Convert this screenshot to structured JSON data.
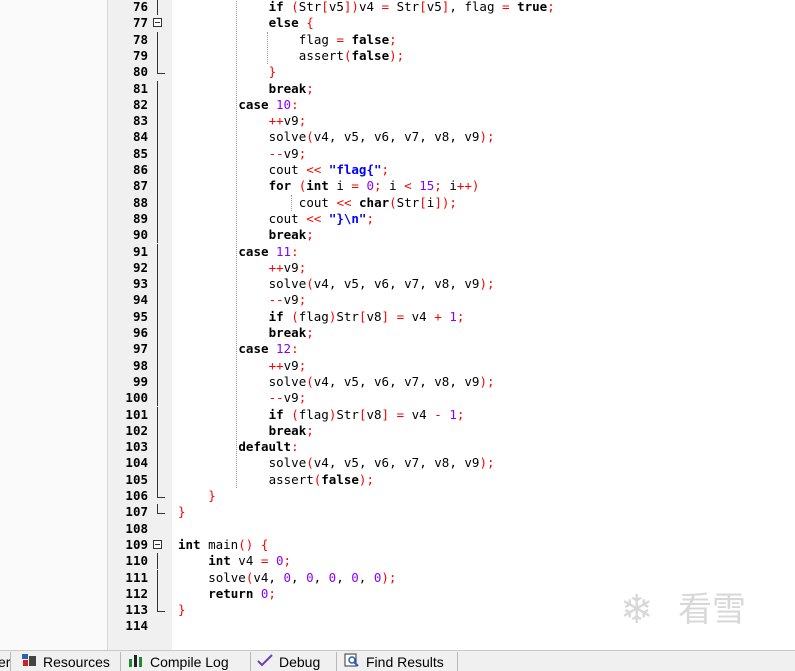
{
  "editor": {
    "lines": [
      {
        "n": "76",
        "code": "if (Str[v5])v4 = Str[v5], flag = true;",
        "indent": 3
      },
      {
        "n": "77",
        "code": "else {",
        "indent": 3
      },
      {
        "n": "78",
        "code": "flag = false;",
        "indent": 4
      },
      {
        "n": "79",
        "code": "assert(false);",
        "indent": 4
      },
      {
        "n": "80",
        "code": "}",
        "indent": 3
      },
      {
        "n": "81",
        "code": "break;",
        "indent": 3
      },
      {
        "n": "82",
        "code": "case 10:",
        "indent": 2
      },
      {
        "n": "83",
        "code": "++v9;",
        "indent": 3
      },
      {
        "n": "84",
        "code": "solve(v4, v5, v6, v7, v8, v9);",
        "indent": 3
      },
      {
        "n": "85",
        "code": "--v9;",
        "indent": 3
      },
      {
        "n": "86",
        "code": "cout << \"flag{\";",
        "indent": 3
      },
      {
        "n": "87",
        "code": "for (int i = 0; i < 15; i++)",
        "indent": 3
      },
      {
        "n": "88",
        "code": "cout << char(Str[i]);",
        "indent": 4
      },
      {
        "n": "89",
        "code": "cout << \"}\\n\";",
        "indent": 3
      },
      {
        "n": "90",
        "code": "break;",
        "indent": 3
      },
      {
        "n": "91",
        "code": "case 11:",
        "indent": 2
      },
      {
        "n": "92",
        "code": "++v9;",
        "indent": 3
      },
      {
        "n": "93",
        "code": "solve(v4, v5, v6, v7, v8, v9);",
        "indent": 3
      },
      {
        "n": "94",
        "code": "--v9;",
        "indent": 3
      },
      {
        "n": "95",
        "code": "if (flag)Str[v8] = v4 + 1;",
        "indent": 3
      },
      {
        "n": "96",
        "code": "break;",
        "indent": 3
      },
      {
        "n": "97",
        "code": "case 12:",
        "indent": 2
      },
      {
        "n": "98",
        "code": "++v9;",
        "indent": 3
      },
      {
        "n": "99",
        "code": "solve(v4, v5, v6, v7, v8, v9);",
        "indent": 3
      },
      {
        "n": "100",
        "code": "--v9;",
        "indent": 3
      },
      {
        "n": "101",
        "code": "if (flag)Str[v8] = v4 - 1;",
        "indent": 3
      },
      {
        "n": "102",
        "code": "break;",
        "indent": 3
      },
      {
        "n": "103",
        "code": "default:",
        "indent": 2
      },
      {
        "n": "104",
        "code": "solve(v4, v5, v6, v7, v8, v9);",
        "indent": 3
      },
      {
        "n": "105",
        "code": "assert(false);",
        "indent": 3
      },
      {
        "n": "106",
        "code": "}",
        "indent": 1
      },
      {
        "n": "107",
        "code": "}",
        "indent": 0
      },
      {
        "n": "108",
        "code": "",
        "indent": 0
      },
      {
        "n": "109",
        "code": "int main() {",
        "indent": 0
      },
      {
        "n": "110",
        "code": "int v4 = 0;",
        "indent": 1
      },
      {
        "n": "111",
        "code": "solve(v4, 0, 0, 0, 0, 0);",
        "indent": 1
      },
      {
        "n": "112",
        "code": "return 0;",
        "indent": 1
      },
      {
        "n": "113",
        "code": "}",
        "indent": 0
      },
      {
        "n": "114",
        "code": "",
        "indent": 0
      }
    ]
  },
  "watermark": {
    "text": "看雪",
    "icon": "snowflake-icon"
  },
  "bottom_tabs": [
    {
      "label": "er",
      "icon": ""
    },
    {
      "label": "Resources",
      "icon": "resources-icon"
    },
    {
      "label": "Compile Log",
      "icon": "compile-log-icon"
    },
    {
      "label": "Debug",
      "icon": "debug-icon"
    },
    {
      "label": "Find Results",
      "icon": "find-results-icon"
    }
  ]
}
